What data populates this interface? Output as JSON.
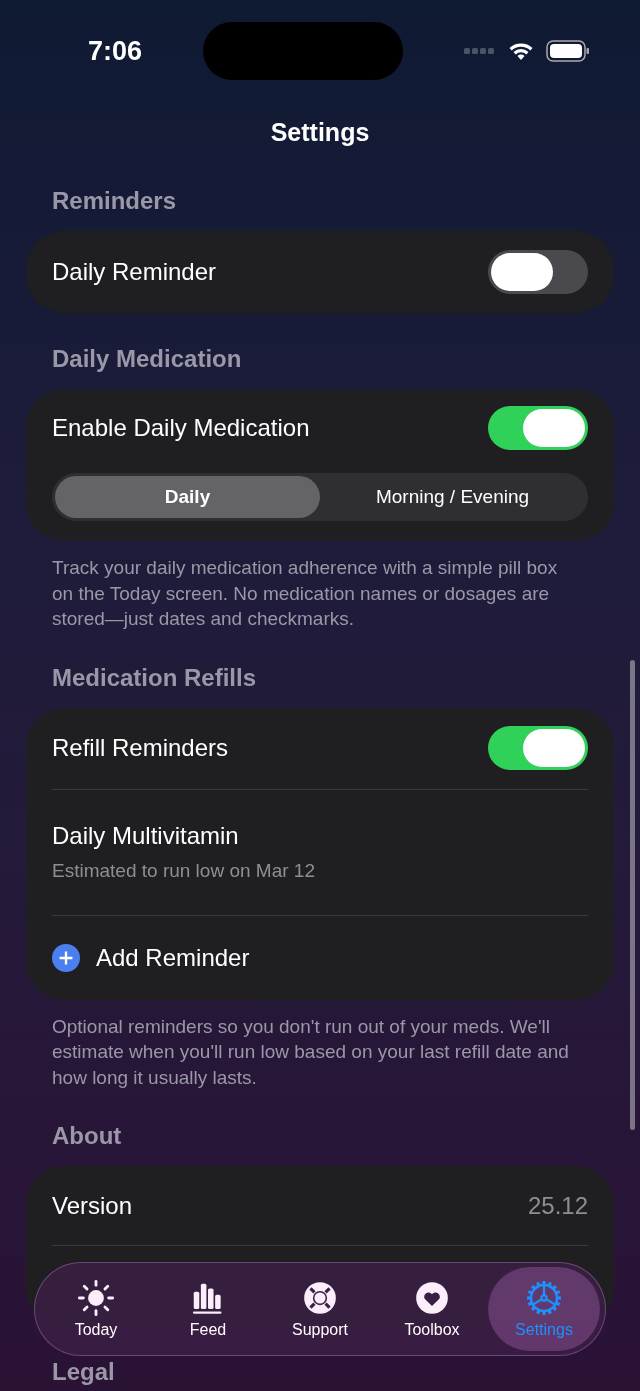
{
  "status_bar": {
    "time": "7:06"
  },
  "title": "Settings",
  "sections": [
    {
      "header": "Reminders",
      "rows": [
        {
          "kind": "toggle",
          "label": "Daily Reminder",
          "on": false
        }
      ]
    },
    {
      "header": "Daily Medication",
      "rows": [
        {
          "kind": "toggle",
          "label": "Enable Daily Medication",
          "on": true
        },
        {
          "kind": "segmented",
          "options": [
            {
              "label": "Daily",
              "selected": true
            },
            {
              "label": "Morning / Evening",
              "selected": false
            }
          ]
        }
      ],
      "footer": "Track your daily medication adherence with a simple pill box on the Today screen. No medication names or dosages are stored—just dates and checkmarks."
    },
    {
      "header": "Medication Refills",
      "rows": [
        {
          "kind": "toggle",
          "label": "Refill Reminders",
          "on": true
        },
        {
          "kind": "item",
          "label": "Daily Multivitamin",
          "subtitle": "Estimated to run low on Mar 12"
        },
        {
          "kind": "add",
          "label": "Add Reminder"
        }
      ],
      "footer": "Optional reminders so you don't run out of your meds. We'll estimate when you'll run low based on your last refill date and how long it usually lasts."
    },
    {
      "header": "About",
      "rows": [
        {
          "kind": "value",
          "label": "Version",
          "value": "25.12"
        },
        {
          "kind": "blank"
        }
      ]
    },
    {
      "header": "Legal"
    }
  ],
  "tab_bar": [
    {
      "label": "Today",
      "selected": false
    },
    {
      "label": "Feed",
      "selected": false
    },
    {
      "label": "Support",
      "selected": false
    },
    {
      "label": "Toolbox",
      "selected": false
    },
    {
      "label": "Settings",
      "selected": true
    }
  ]
}
